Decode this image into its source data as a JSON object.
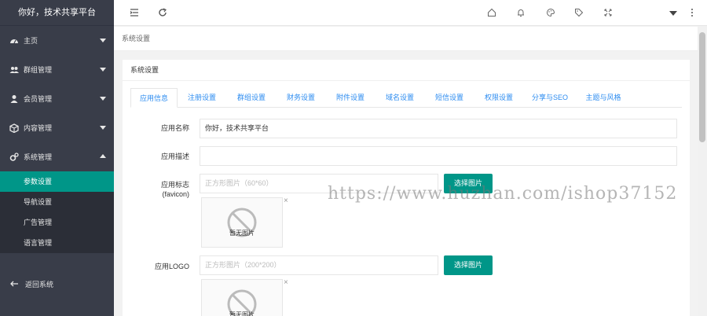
{
  "sidebar": {
    "brand": "你好，技术共享平台",
    "items": [
      {
        "label": "主页",
        "icon": "dashboard-icon"
      },
      {
        "label": "群组管理",
        "icon": "users-icon"
      },
      {
        "label": "会员管理",
        "icon": "user-icon"
      },
      {
        "label": "内容管理",
        "icon": "cube-icon"
      },
      {
        "label": "系统管理",
        "icon": "gears-icon"
      }
    ],
    "sub_items": [
      "参数设置",
      "导航设置",
      "广告管理",
      "语言管理"
    ],
    "back_label": "返回系统"
  },
  "breadcrumb": "系统设置",
  "card": {
    "title": "系统设置",
    "tabs": [
      "应用信息",
      "注册设置",
      "群组设置",
      "财务设置",
      "附件设置",
      "域名设置",
      "短信设置",
      "权限设置",
      "分享与SEO",
      "主题与风格"
    ],
    "fields": {
      "app_name_label": "应用名称",
      "app_name_value": "你好，技术共享平台",
      "app_desc_label": "应用描述",
      "favicon_label_1": "应用标志",
      "favicon_label_2": "(favicon)",
      "favicon_placeholder": "正方形图片（60*60）",
      "logo_label": "应用LOGO",
      "logo_placeholder": "正方形图片（200*200）",
      "select_button": "选择图片",
      "no_image": "暂无图片",
      "close": "×"
    }
  },
  "watermark": "https://www.huzhan.com/ishop37152",
  "colors": {
    "sidebar": "#393d49",
    "accent": "#009688",
    "tab_text": "#2d8cf0"
  }
}
